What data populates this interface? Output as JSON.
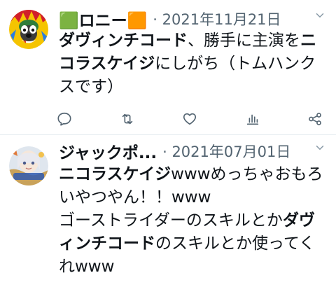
{
  "tweets": [
    {
      "user_name": "🟩ロニー🟧",
      "separator": "·",
      "date": "2021年11月21日",
      "more_icon": "chevron-down-icon",
      "body": [
        {
          "text": "ダヴィンチコード",
          "bold": true
        },
        {
          "text": "、勝手に主演を",
          "bold": false
        },
        {
          "text": "ニコラスケイジ",
          "bold": true
        },
        {
          "text": "にしがち（トムハンクスです）",
          "bold": false
        }
      ],
      "actions": [
        "reply-icon",
        "retweet-icon",
        "like-icon",
        "analytics-icon",
        "share-icon"
      ]
    },
    {
      "user_name": "ジャックポ...",
      "separator": "·",
      "date": "2021年07月01日",
      "more_icon": "chevron-down-icon",
      "body": [
        {
          "text": "ニコラスケイジ",
          "bold": true
        },
        {
          "text": "wwwめっちゃおもろいやつやん！！www",
          "bold": false
        },
        {
          "text": "\n",
          "bold": false
        },
        {
          "text": "ゴーストライダーのスキルとか",
          "bold": false
        },
        {
          "text": "ダヴィンチコード",
          "bold": true
        },
        {
          "text": "のスキルとか使ってくれwww",
          "bold": false
        }
      ]
    }
  ],
  "colors": {
    "text": "#0f1419",
    "meta": "#536471",
    "icon": "#536471",
    "divider": "#e6ecf0"
  }
}
